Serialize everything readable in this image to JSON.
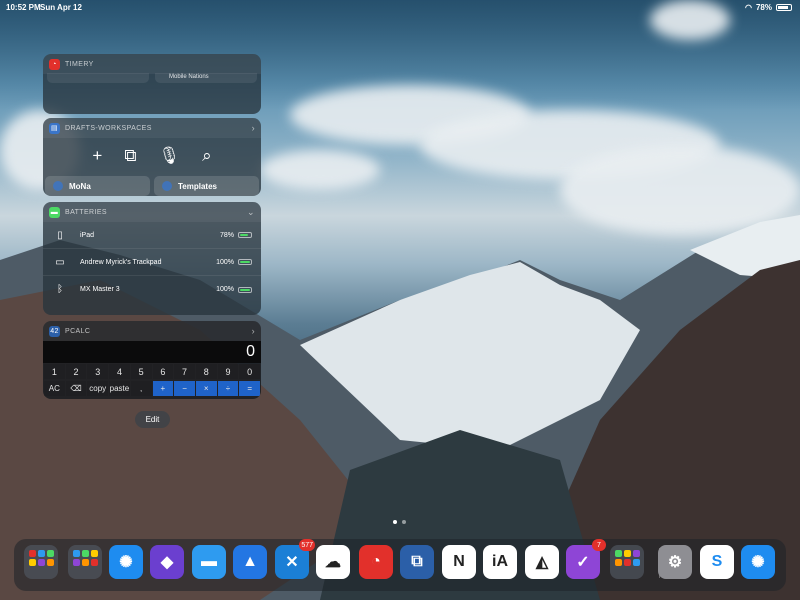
{
  "status_bar": {
    "time": "10:52 PM",
    "date": "Sun Apr 12",
    "battery": "78%"
  },
  "widgets": {
    "timery": {
      "title": "TIMERY",
      "chips": [
        "",
        "Mobile Nations"
      ]
    },
    "drafts": {
      "title": "DRAFTS-WORKSPACES",
      "actions": [
        {
          "icon": "plus-icon",
          "glyph": "+"
        },
        {
          "icon": "copy-icon",
          "glyph": "⧉"
        },
        {
          "icon": "microphone-icon",
          "glyph": "🎙"
        },
        {
          "icon": "search-icon",
          "glyph": "⌕"
        }
      ],
      "buttons": [
        "MoNa",
        "Templates"
      ]
    },
    "batteries": {
      "title": "BATTERIES",
      "devices": [
        {
          "name": "iPad",
          "percent": "78%",
          "level": 0.78,
          "icon": "ipad-icon",
          "glyph": "▯"
        },
        {
          "name": "Andrew Myrick's Trackpad",
          "percent": "100%",
          "level": 1.0,
          "icon": "trackpad-icon",
          "glyph": "▭"
        },
        {
          "name": "MX Master 3",
          "percent": "100%",
          "level": 1.0,
          "icon": "bluetooth-icon",
          "glyph": "ᛒ"
        }
      ]
    },
    "pcalc": {
      "title": "PCALC",
      "display": "0",
      "row1": [
        "1",
        "2",
        "3",
        "4",
        "5",
        "6",
        "7",
        "8",
        "9",
        "0"
      ],
      "row2": [
        "AC",
        "⌫",
        "copy",
        "paste",
        ",",
        "+",
        "−",
        "×",
        "÷",
        "="
      ]
    }
  },
  "edit_label": "Edit",
  "dock": {
    "apps": [
      {
        "name": "folder-1",
        "type": "folder",
        "badge": ""
      },
      {
        "name": "folder-2",
        "type": "folder",
        "badge": ""
      },
      {
        "name": "safari",
        "glyph": "✺",
        "bg": "#1e8cf0",
        "badge": ""
      },
      {
        "name": "shortcuts",
        "glyph": "◆",
        "bg": "#6b3fcf",
        "badge": ""
      },
      {
        "name": "files",
        "glyph": "▬",
        "bg": "#2e9bf0",
        "badge": ""
      },
      {
        "name": "spark",
        "glyph": "▲",
        "bg": "#2376e3",
        "badge": ""
      },
      {
        "name": "tweetbot-tasks",
        "glyph": "✕",
        "bg": "#1b7fd6",
        "badge": "577"
      },
      {
        "name": "icloud",
        "glyph": "☁",
        "bg": "#ffffff",
        "badge": ""
      },
      {
        "name": "timery",
        "glyph": "◔",
        "bg": "#e2302b",
        "badge": ""
      },
      {
        "name": "screens",
        "glyph": "⧉",
        "bg": "#2b5fa8",
        "badge": ""
      },
      {
        "name": "notion",
        "glyph": "N",
        "bg": "#ffffff",
        "badge": ""
      },
      {
        "name": "ia-writer",
        "glyph": "iA",
        "bg": "#ffffff",
        "badge": ""
      },
      {
        "name": "airtable",
        "glyph": "◭",
        "bg": "#ffffff",
        "badge": ""
      },
      {
        "name": "omnifocus",
        "glyph": "✓",
        "bg": "#8e45d6",
        "badge": "7"
      },
      {
        "name": "folder-3",
        "type": "folder",
        "badge": ""
      },
      {
        "name": "settings",
        "glyph": "⚙",
        "bg": "#8e8e93",
        "badge": ""
      },
      {
        "name": "skype",
        "glyph": "S",
        "bg": "#ffffff",
        "badge": ""
      },
      {
        "name": "safari-2",
        "glyph": "✺",
        "bg": "#1e8cf0",
        "badge": ""
      }
    ]
  }
}
